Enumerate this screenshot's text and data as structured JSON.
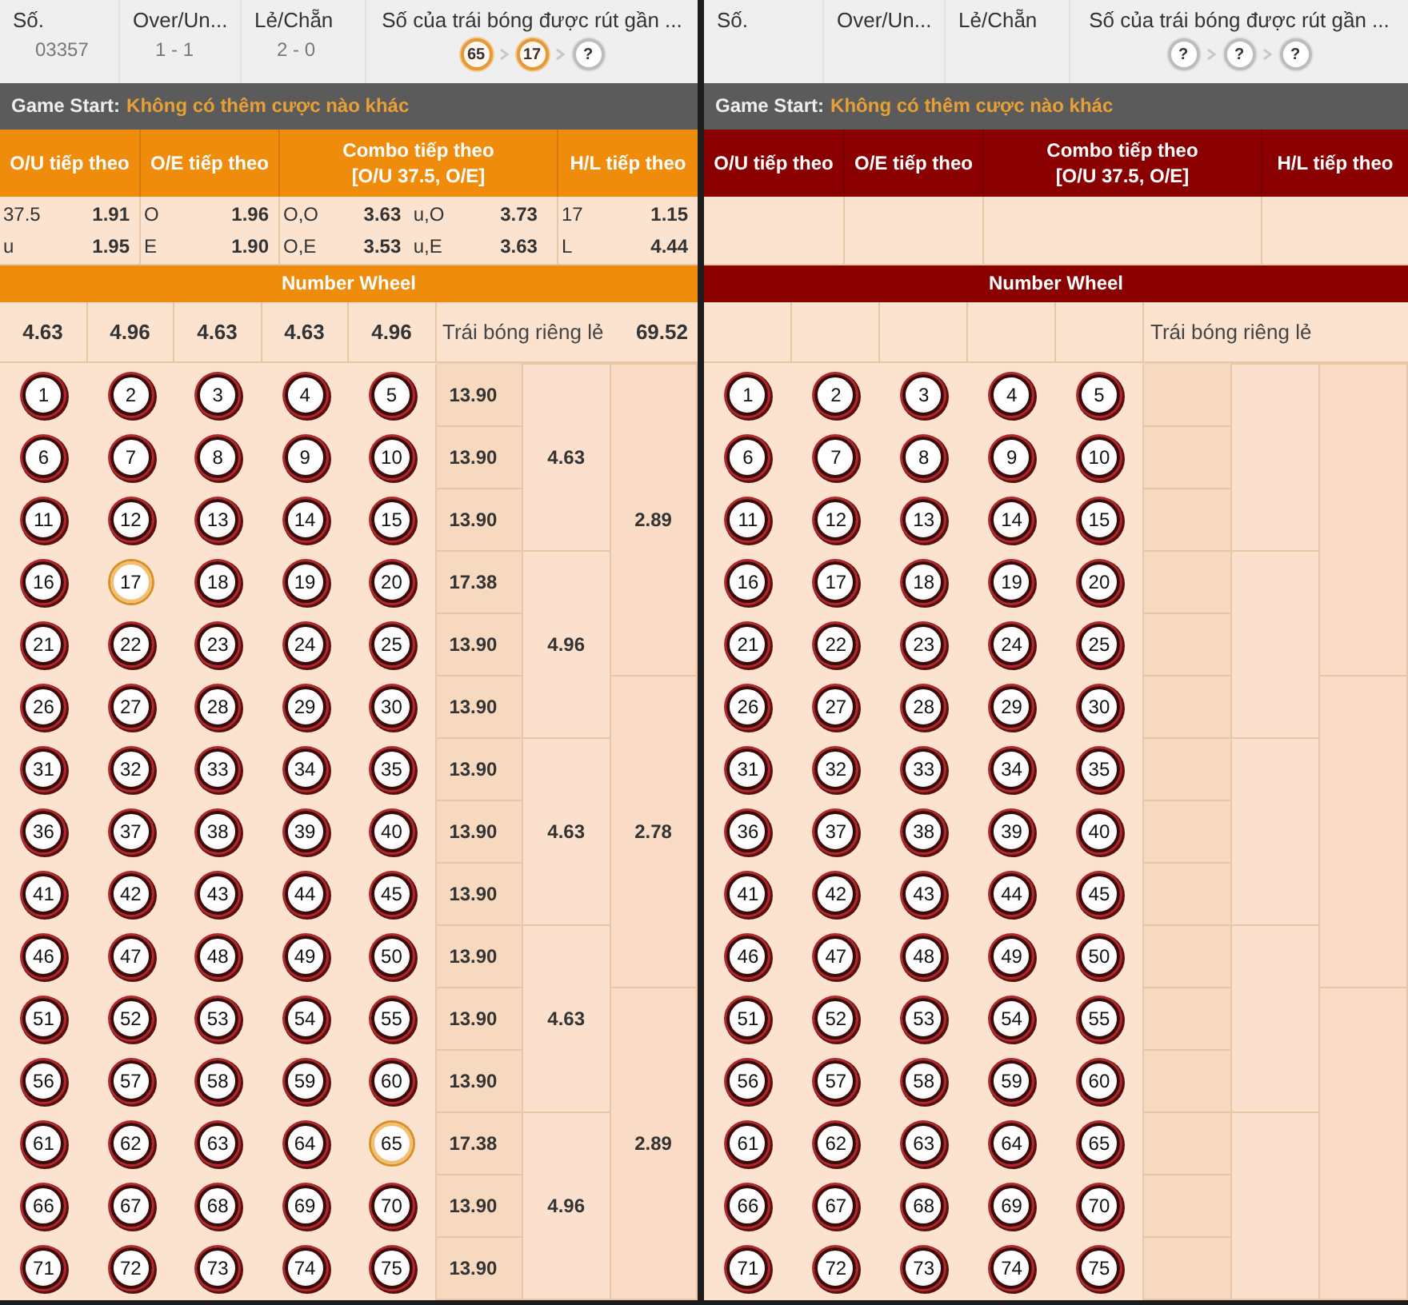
{
  "panels": [
    {
      "color": "#f08c0c",
      "header": {
        "labels": [
          "Số.",
          "Over/Un...",
          "Lẻ/Chẵn",
          "Số của trái bóng được rút gần ..."
        ],
        "values": [
          "03357",
          "1 - 1",
          "2 - 0"
        ],
        "recent_balls": [
          {
            "label": "65",
            "drawn": true
          },
          {
            "label": "17",
            "drawn": true
          },
          {
            "label": "?",
            "drawn": false
          }
        ]
      },
      "game_start": {
        "label": "Game Start:",
        "status": "Không có thêm cược nào khác"
      },
      "bet_headers": {
        "ou": "O/U tiếp theo",
        "oe": "O/E tiếp theo",
        "combo_title": "Combo tiếp theo",
        "combo_subtitle": "[O/U 37.5, O/E]",
        "hl": "H/L tiếp theo"
      },
      "odds_rows": [
        {
          "ou_label": "37.5",
          "ou_odds": "1.91",
          "oe_label": "O",
          "oe_odds": "1.96",
          "combo": [
            {
              "label": "O,O",
              "odds": "3.63"
            },
            {
              "label": "u,O",
              "odds": "3.73"
            }
          ],
          "hl_label": "17",
          "hl_odds": "1.15"
        },
        {
          "ou_label": "u",
          "ou_odds": "1.95",
          "oe_label": "E",
          "oe_odds": "1.90",
          "combo": [
            {
              "label": "O,E",
              "odds": "3.53"
            },
            {
              "label": "u,E",
              "odds": "3.63"
            }
          ],
          "hl_label": "L",
          "hl_odds": "4.44"
        }
      ],
      "wheel_title": "Number Wheel",
      "wheel_odds": [
        "4.63",
        "4.96",
        "4.63",
        "4.63",
        "4.96"
      ],
      "single_ball_label": "Trái bóng riêng lẻ",
      "single_ball_odds": "69.52",
      "ball_rows": [
        {
          "odds": "13.90",
          "balls": [
            {
              "label": "1",
              "highlighted": false
            },
            {
              "label": "2",
              "highlighted": false
            },
            {
              "label": "3",
              "highlighted": false
            },
            {
              "label": "4",
              "highlighted": false
            },
            {
              "label": "5",
              "highlighted": false
            }
          ]
        },
        {
          "odds": "13.90",
          "balls": [
            {
              "label": "6",
              "highlighted": false
            },
            {
              "label": "7",
              "highlighted": false
            },
            {
              "label": "8",
              "highlighted": false
            },
            {
              "label": "9",
              "highlighted": false
            },
            {
              "label": "10",
              "highlighted": false
            }
          ]
        },
        {
          "odds": "13.90",
          "balls": [
            {
              "label": "11",
              "highlighted": false
            },
            {
              "label": "12",
              "highlighted": false
            },
            {
              "label": "13",
              "highlighted": false
            },
            {
              "label": "14",
              "highlighted": false
            },
            {
              "label": "15",
              "highlighted": false
            }
          ]
        },
        {
          "odds": "17.38",
          "balls": [
            {
              "label": "16",
              "highlighted": false
            },
            {
              "label": "17",
              "highlighted": true
            },
            {
              "label": "18",
              "highlighted": false
            },
            {
              "label": "19",
              "highlighted": false
            },
            {
              "label": "20",
              "highlighted": false
            }
          ]
        },
        {
          "odds": "13.90",
          "balls": [
            {
              "label": "21",
              "highlighted": false
            },
            {
              "label": "22",
              "highlighted": false
            },
            {
              "label": "23",
              "highlighted": false
            },
            {
              "label": "24",
              "highlighted": false
            },
            {
              "label": "25",
              "highlighted": false
            }
          ]
        },
        {
          "odds": "13.90",
          "balls": [
            {
              "label": "26",
              "highlighted": false
            },
            {
              "label": "27",
              "highlighted": false
            },
            {
              "label": "28",
              "highlighted": false
            },
            {
              "label": "29",
              "highlighted": false
            },
            {
              "label": "30",
              "highlighted": false
            }
          ]
        },
        {
          "odds": "13.90",
          "balls": [
            {
              "label": "31",
              "highlighted": false
            },
            {
              "label": "32",
              "highlighted": false
            },
            {
              "label": "33",
              "highlighted": false
            },
            {
              "label": "34",
              "highlighted": false
            },
            {
              "label": "35",
              "highlighted": false
            }
          ]
        },
        {
          "odds": "13.90",
          "balls": [
            {
              "label": "36",
              "highlighted": false
            },
            {
              "label": "37",
              "highlighted": false
            },
            {
              "label": "38",
              "highlighted": false
            },
            {
              "label": "39",
              "highlighted": false
            },
            {
              "label": "40",
              "highlighted": false
            }
          ]
        },
        {
          "odds": "13.90",
          "balls": [
            {
              "label": "41",
              "highlighted": false
            },
            {
              "label": "42",
              "highlighted": false
            },
            {
              "label": "43",
              "highlighted": false
            },
            {
              "label": "44",
              "highlighted": false
            },
            {
              "label": "45",
              "highlighted": false
            }
          ]
        },
        {
          "odds": "13.90",
          "balls": [
            {
              "label": "46",
              "highlighted": false
            },
            {
              "label": "47",
              "highlighted": false
            },
            {
              "label": "48",
              "highlighted": false
            },
            {
              "label": "49",
              "highlighted": false
            },
            {
              "label": "50",
              "highlighted": false
            }
          ]
        },
        {
          "odds": "13.90",
          "balls": [
            {
              "label": "51",
              "highlighted": false
            },
            {
              "label": "52",
              "highlighted": false
            },
            {
              "label": "53",
              "highlighted": false
            },
            {
              "label": "54",
              "highlighted": false
            },
            {
              "label": "55",
              "highlighted": false
            }
          ]
        },
        {
          "odds": "13.90",
          "balls": [
            {
              "label": "56",
              "highlighted": false
            },
            {
              "label": "57",
              "highlighted": false
            },
            {
              "label": "58",
              "highlighted": false
            },
            {
              "label": "59",
              "highlighted": false
            },
            {
              "label": "60",
              "highlighted": false
            }
          ]
        },
        {
          "odds": "17.38",
          "balls": [
            {
              "label": "61",
              "highlighted": false
            },
            {
              "label": "62",
              "highlighted": false
            },
            {
              "label": "63",
              "highlighted": false
            },
            {
              "label": "64",
              "highlighted": false
            },
            {
              "label": "65",
              "highlighted": true
            }
          ]
        },
        {
          "odds": "13.90",
          "balls": [
            {
              "label": "66",
              "highlighted": false
            },
            {
              "label": "67",
              "highlighted": false
            },
            {
              "label": "68",
              "highlighted": false
            },
            {
              "label": "69",
              "highlighted": false
            },
            {
              "label": "70",
              "highlighted": false
            }
          ]
        },
        {
          "odds": "13.90",
          "balls": [
            {
              "label": "71",
              "highlighted": false
            },
            {
              "label": "72",
              "highlighted": false
            },
            {
              "label": "73",
              "highlighted": false
            },
            {
              "label": "74",
              "highlighted": false
            },
            {
              "label": "75",
              "highlighted": false
            }
          ]
        }
      ],
      "group_odds": [
        "4.63",
        "4.96",
        "4.63",
        "4.63",
        "4.96"
      ],
      "band_odds": [
        "2.89",
        "2.78",
        "2.89"
      ]
    },
    {
      "color": "#8a0000",
      "header": {
        "labels": [
          "Số.",
          "Over/Un...",
          "Lẻ/Chẵn",
          "Số của trái bóng được rút gần ..."
        ],
        "recent_balls": [
          {
            "label": "?",
            "drawn": false
          },
          {
            "label": "?",
            "drawn": false
          },
          {
            "label": "?",
            "drawn": false
          }
        ]
      },
      "game_start": {
        "label": "Game Start:",
        "status": "Không có thêm cược nào khác"
      },
      "bet_headers": {
        "ou": "O/U tiếp theo",
        "oe": "O/E tiếp theo",
        "combo_title": "Combo tiếp theo",
        "combo_subtitle": "[O/U 37.5, O/E]",
        "hl": "H/L tiếp theo"
      },
      "wheel_title": "Number Wheel",
      "single_ball_label": "Trái bóng riêng lẻ",
      "ball_rows": [
        {
          "balls": [
            {
              "label": "1",
              "highlighted": false
            },
            {
              "label": "2",
              "highlighted": false
            },
            {
              "label": "3",
              "highlighted": false
            },
            {
              "label": "4",
              "highlighted": false
            },
            {
              "label": "5",
              "highlighted": false
            }
          ]
        },
        {
          "balls": [
            {
              "label": "6",
              "highlighted": false
            },
            {
              "label": "7",
              "highlighted": false
            },
            {
              "label": "8",
              "highlighted": false
            },
            {
              "label": "9",
              "highlighted": false
            },
            {
              "label": "10",
              "highlighted": false
            }
          ]
        },
        {
          "balls": [
            {
              "label": "11",
              "highlighted": false
            },
            {
              "label": "12",
              "highlighted": false
            },
            {
              "label": "13",
              "highlighted": false
            },
            {
              "label": "14",
              "highlighted": false
            },
            {
              "label": "15",
              "highlighted": false
            }
          ]
        },
        {
          "balls": [
            {
              "label": "16",
              "highlighted": false
            },
            {
              "label": "17",
              "highlighted": false
            },
            {
              "label": "18",
              "highlighted": false
            },
            {
              "label": "19",
              "highlighted": false
            },
            {
              "label": "20",
              "highlighted": false
            }
          ]
        },
        {
          "balls": [
            {
              "label": "21",
              "highlighted": false
            },
            {
              "label": "22",
              "highlighted": false
            },
            {
              "label": "23",
              "highlighted": false
            },
            {
              "label": "24",
              "highlighted": false
            },
            {
              "label": "25",
              "highlighted": false
            }
          ]
        },
        {
          "balls": [
            {
              "label": "26",
              "highlighted": false
            },
            {
              "label": "27",
              "highlighted": false
            },
            {
              "label": "28",
              "highlighted": false
            },
            {
              "label": "29",
              "highlighted": false
            },
            {
              "label": "30",
              "highlighted": false
            }
          ]
        },
        {
          "balls": [
            {
              "label": "31",
              "highlighted": false
            },
            {
              "label": "32",
              "highlighted": false
            },
            {
              "label": "33",
              "highlighted": false
            },
            {
              "label": "34",
              "highlighted": false
            },
            {
              "label": "35",
              "highlighted": false
            }
          ]
        },
        {
          "balls": [
            {
              "label": "36",
              "highlighted": false
            },
            {
              "label": "37",
              "highlighted": false
            },
            {
              "label": "38",
              "highlighted": false
            },
            {
              "label": "39",
              "highlighted": false
            },
            {
              "label": "40",
              "highlighted": false
            }
          ]
        },
        {
          "balls": [
            {
              "label": "41",
              "highlighted": false
            },
            {
              "label": "42",
              "highlighted": false
            },
            {
              "label": "43",
              "highlighted": false
            },
            {
              "label": "44",
              "highlighted": false
            },
            {
              "label": "45",
              "highlighted": false
            }
          ]
        },
        {
          "balls": [
            {
              "label": "46",
              "highlighted": false
            },
            {
              "label": "47",
              "highlighted": false
            },
            {
              "label": "48",
              "highlighted": false
            },
            {
              "label": "49",
              "highlighted": false
            },
            {
              "label": "50",
              "highlighted": false
            }
          ]
        },
        {
          "balls": [
            {
              "label": "51",
              "highlighted": false
            },
            {
              "label": "52",
              "highlighted": false
            },
            {
              "label": "53",
              "highlighted": false
            },
            {
              "label": "54",
              "highlighted": false
            },
            {
              "label": "55",
              "highlighted": false
            }
          ]
        },
        {
          "balls": [
            {
              "label": "56",
              "highlighted": false
            },
            {
              "label": "57",
              "highlighted": false
            },
            {
              "label": "58",
              "highlighted": false
            },
            {
              "label": "59",
              "highlighted": false
            },
            {
              "label": "60",
              "highlighted": false
            }
          ]
        },
        {
          "balls": [
            {
              "label": "61",
              "highlighted": false
            },
            {
              "label": "62",
              "highlighted": false
            },
            {
              "label": "63",
              "highlighted": false
            },
            {
              "label": "64",
              "highlighted": false
            },
            {
              "label": "65",
              "highlighted": false
            }
          ]
        },
        {
          "balls": [
            {
              "label": "66",
              "highlighted": false
            },
            {
              "label": "67",
              "highlighted": false
            },
            {
              "label": "68",
              "highlighted": false
            },
            {
              "label": "69",
              "highlighted": false
            },
            {
              "label": "70",
              "highlighted": false
            }
          ]
        },
        {
          "balls": [
            {
              "label": "71",
              "highlighted": false
            },
            {
              "label": "72",
              "highlighted": false
            },
            {
              "label": "73",
              "highlighted": false
            },
            {
              "label": "74",
              "highlighted": false
            },
            {
              "label": "75",
              "highlighted": false
            }
          ]
        }
      ]
    }
  ]
}
